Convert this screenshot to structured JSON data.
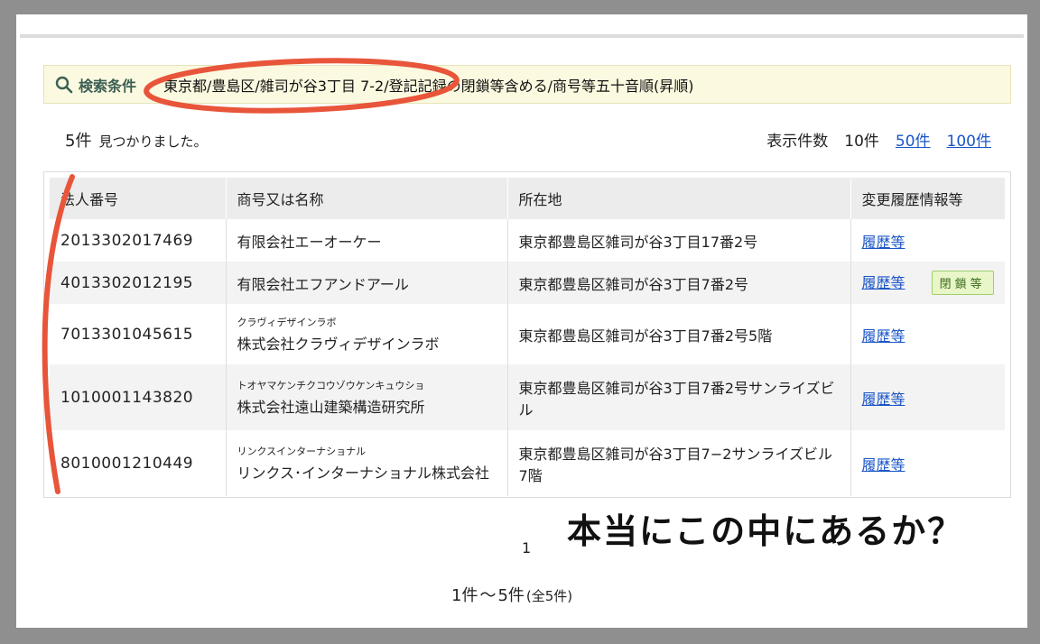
{
  "search": {
    "label": "検索条件",
    "value": "東京都/豊島区/雑司が谷3丁目 7-2/登記記録の閉鎖等含める/商号等五十音順(昇順)"
  },
  "results": {
    "count": "5件",
    "found_text": "見つかりました。"
  },
  "per_page": {
    "label": "表示件数",
    "current": "10件",
    "option_50": "50件",
    "option_100": "100件"
  },
  "table": {
    "headers": [
      "法人番号",
      "商号又は名称",
      "所在地",
      "変更履歴情報等"
    ],
    "history_label": "履歴等",
    "closed_label": "閉鎖等",
    "rows": [
      {
        "corp_no": "2013302017469",
        "kana": "",
        "name": "有限会社エーオーケー",
        "address": "東京都豊島区雑司が谷3丁目17番2号"
      },
      {
        "corp_no": "4013302012195",
        "kana": "",
        "name": "有限会社エフアンドアール",
        "address": "東京都豊島区雑司が谷3丁目7番2号"
      },
      {
        "corp_no": "7013301045615",
        "kana": "クラヴィデザインラボ",
        "name": "株式会社クラヴィデザインラボ",
        "address": "東京都豊島区雑司が谷3丁目7番2号5階"
      },
      {
        "corp_no": "1010001143820",
        "kana": "トオヤマケンチクコウゾウケンキュウショ",
        "name": "株式会社遠山建築構造研究所",
        "address": "東京都豊島区雑司が谷3丁目7番2号サンライズビル"
      },
      {
        "corp_no": "8010001210449",
        "kana": "リンクスインターナショナル",
        "name": "リンクス･インターナショナル株式会社",
        "address": "東京都豊島区雑司が谷3丁目7−2サンライズビル7階"
      }
    ]
  },
  "pagination": {
    "page": "1",
    "range_start": "1件",
    "range_sep": "～",
    "range_end": "5件",
    "total": "(全5件)"
  },
  "annotation": {
    "text": "本当にこの中にあるか？",
    "color": "#e8553a"
  }
}
